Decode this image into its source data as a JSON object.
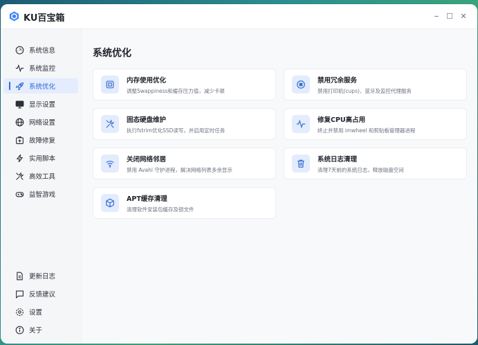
{
  "app": {
    "title": "KU百宝箱"
  },
  "window_controls": {
    "minimize": "–",
    "maximize": "☐",
    "close": "✕"
  },
  "sidebar": {
    "items": [
      {
        "label": "系统信息",
        "icon": "gauge-icon",
        "active": false
      },
      {
        "label": "系统监控",
        "icon": "pulse-icon",
        "active": false
      },
      {
        "label": "系统优化",
        "icon": "rocket-icon",
        "active": true
      },
      {
        "label": "显示设置",
        "icon": "monitor-icon",
        "active": false
      },
      {
        "label": "网络设置",
        "icon": "globe-icon",
        "active": false
      },
      {
        "label": "故障修复",
        "icon": "repair-box-icon",
        "active": false
      },
      {
        "label": "实用脚本",
        "icon": "lightning-icon",
        "active": false
      },
      {
        "label": "高效工具",
        "icon": "tools-icon",
        "active": false
      },
      {
        "label": "益智游戏",
        "icon": "gamepad-icon",
        "active": false
      }
    ],
    "bottom_items": [
      {
        "label": "更新日志",
        "icon": "document-icon"
      },
      {
        "label": "反馈建议",
        "icon": "chat-icon"
      },
      {
        "label": "设置",
        "icon": "gear-icon"
      },
      {
        "label": "关于",
        "icon": "info-icon"
      }
    ]
  },
  "main": {
    "title": "系统优化",
    "cards": [
      {
        "title": "内存使用优化",
        "desc": "调整Swappiness和缓存压力值，减少卡顿",
        "icon": "memory-chip-icon"
      },
      {
        "title": "禁用冗余服务",
        "desc": "禁用打印机(cups)、蓝牙及监控代理服务",
        "icon": "stop-circle-icon"
      },
      {
        "title": "固态硬盘维护",
        "desc": "执行fstrim优化SSD读写，并启用定时任务",
        "icon": "tools-icon"
      },
      {
        "title": "修复CPU高占用",
        "desc": "终止并禁用 imwheel 和剪贴板管理器进程",
        "icon": "pulse-icon"
      },
      {
        "title": "关闭网络邻居",
        "desc": "禁用 Avahi 守护进程，解决网络列表多余显示",
        "icon": "wifi-icon"
      },
      {
        "title": "系统日志清理",
        "desc": "清理7天前的系统日志，释放磁盘空间",
        "icon": "trash-icon"
      },
      {
        "title": "APT缓存清理",
        "desc": "清理软件安装包缓存及锁文件",
        "icon": "package-icon"
      }
    ]
  },
  "colors": {
    "accent": "#2f6bd8",
    "icon_bg": "#e3ecfd",
    "sidebar_bg": "#f5f6f8"
  }
}
